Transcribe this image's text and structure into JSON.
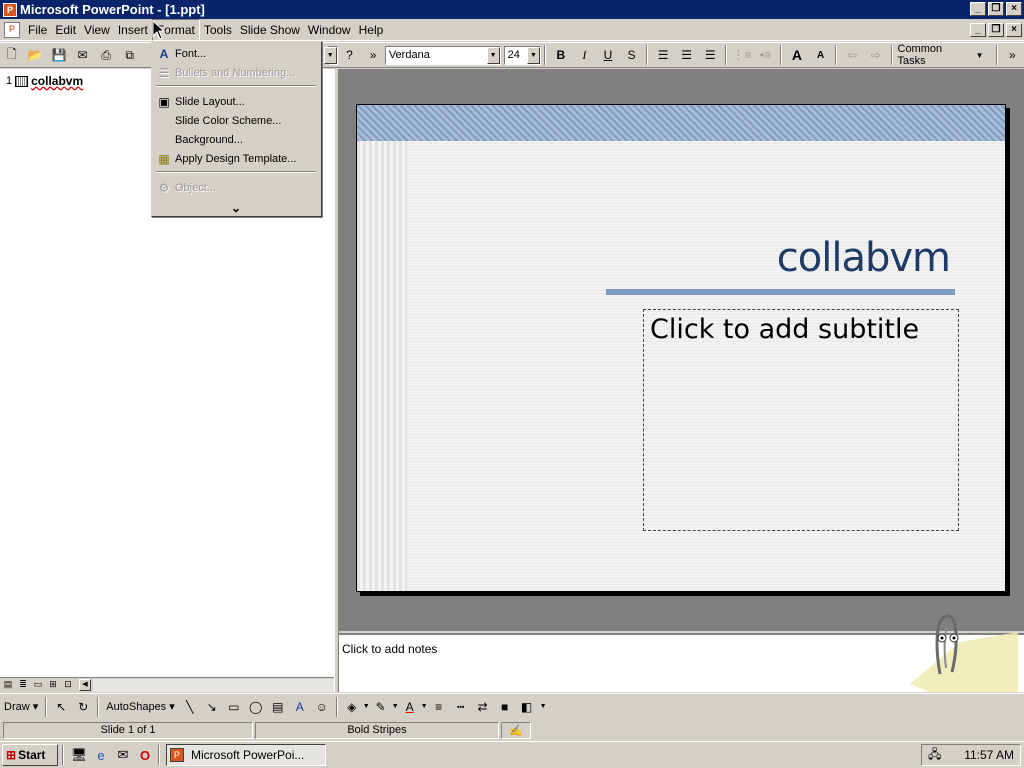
{
  "window": {
    "title": "Microsoft PowerPoint - [1.ppt]",
    "min": "_",
    "restore": "❐",
    "close": "×"
  },
  "menubar": {
    "items": [
      "File",
      "Edit",
      "View",
      "Insert",
      "Format",
      "Tools",
      "Slide Show",
      "Window",
      "Help"
    ]
  },
  "toolbar": {
    "font_name": "Verdana",
    "font_size": "24",
    "common_tasks": "Common Tasks"
  },
  "format_menu": {
    "font": "Font...",
    "bullets": "Bullets and Numbering...",
    "slide_layout": "Slide Layout...",
    "slide_color_scheme": "Slide Color Scheme...",
    "background": "Background...",
    "apply_design_template": "Apply Design Template...",
    "object": "Object...",
    "expand": "⌄"
  },
  "outline": {
    "number": "1",
    "title": "collabvm"
  },
  "slide": {
    "title": "collabvm",
    "subtitle_placeholder": "Click to add subtitle"
  },
  "notes": {
    "placeholder": "Click to add notes"
  },
  "drawing": {
    "draw": "Draw",
    "autoshapes": "AutoShapes"
  },
  "status": {
    "slide": "Slide 1 of 1",
    "design": "Bold Stripes"
  },
  "taskbar": {
    "start": "Start",
    "task": "Microsoft PowerPoi...",
    "time": "11:57 AM"
  }
}
